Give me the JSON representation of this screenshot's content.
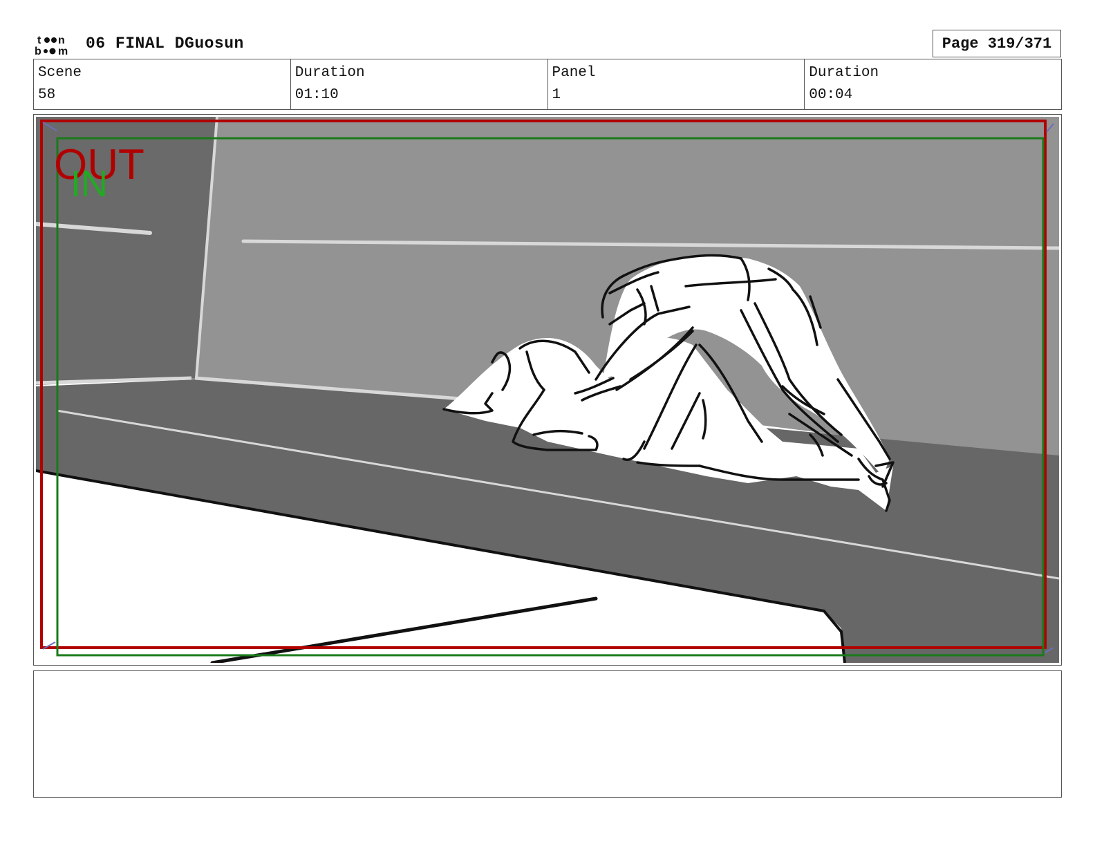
{
  "header": {
    "logo_text": "toon boom",
    "title": "06 FINAL DGuosun",
    "page": "Page 319/371"
  },
  "info": [
    {
      "label": "Scene",
      "value": "58"
    },
    {
      "label": "Duration",
      "value": "01:10"
    },
    {
      "label": "Panel",
      "value": "1"
    },
    {
      "label": "Duration",
      "value": "00:04"
    }
  ],
  "panel": {
    "out_label": "OUT",
    "in_label": "IN",
    "colors": {
      "out_frame": "#b00000",
      "in_frame": "#1a7a1a",
      "in_text": "#22aa22",
      "wall": "#8f8f8f",
      "wall_left": "#6a6a6a",
      "floor": "#676767"
    }
  },
  "notes": {
    "text": ""
  }
}
